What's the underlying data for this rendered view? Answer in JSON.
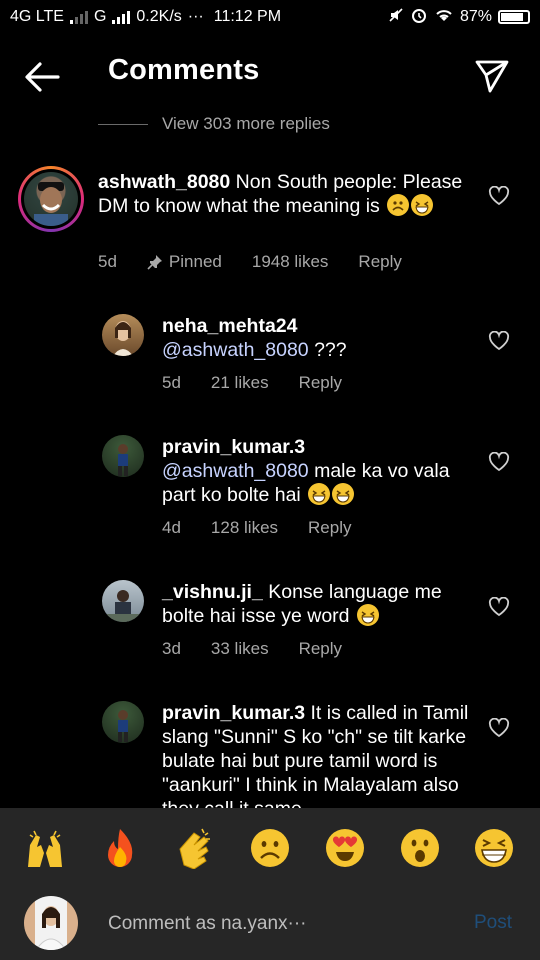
{
  "status_bar": {
    "network1": "4G LTE",
    "network2": "G",
    "speed": "0.2K/s",
    "dots": "···",
    "time": "11:12 PM",
    "battery": "87%",
    "battery_level": 0.87
  },
  "header": {
    "title": "Comments",
    "back_icon": "arrow-left-icon",
    "share_icon": "paper-plane-icon"
  },
  "view_more": "View 303 more replies",
  "comments": [
    {
      "username": "ashwath_8080",
      "text": "Non South people: Please DM to know what the meaning is",
      "time": "5d",
      "pinned": "Pinned",
      "likes": "1948 likes",
      "reply": "Reply"
    },
    {
      "username": "neha_mehta24",
      "mention": "@ashwath_8080",
      "text": "???",
      "time": "5d",
      "likes": "21 likes",
      "reply": "Reply"
    },
    {
      "username": "pravin_kumar.3",
      "mention": "@ashwath_8080",
      "text": "male ka vo vala part ko bolte hai",
      "time": "4d",
      "likes": "128 likes",
      "reply": "Reply"
    },
    {
      "username": "_vishnu.ji_",
      "text": "Konse language me bolte hai isse ye word",
      "time": "3d",
      "likes": "33 likes",
      "reply": "Reply"
    },
    {
      "username": "pravin_kumar.3",
      "text": "It is called in Tamil slang \"Sunni\"  S  ko \"ch\" se tilt karke bulate hai but pure tamil word is \"aankuri\" I think in Malayalam also they call it same"
    }
  ],
  "emoji_bar": [
    "raising-hands",
    "fire",
    "clapping-hands",
    "frowning-face",
    "heart-eyes-face",
    "astonished-face",
    "grinning-squinting-face"
  ],
  "composer": {
    "placeholder": "Comment as na.yanx···",
    "post": "Post"
  }
}
